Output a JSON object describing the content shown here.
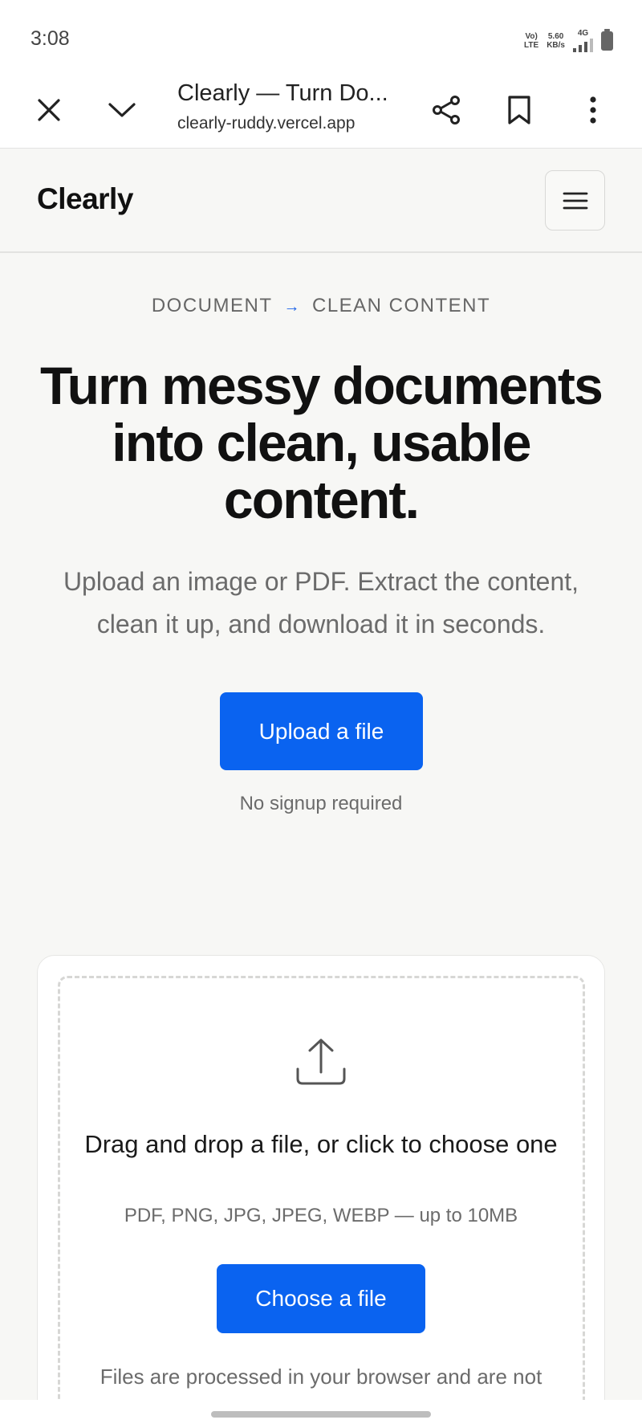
{
  "status_bar": {
    "time": "3:08",
    "network_label_top": "Vo)",
    "network_label_bottom": "LTE",
    "speed_value": "5.60",
    "speed_unit": "KB/s",
    "network_type": "4G"
  },
  "browser": {
    "close_icon": "close-icon",
    "collapse_icon": "chevron-down-icon",
    "page_title": "Clearly — Turn Do...",
    "url": "clearly-ruddy.vercel.app",
    "share_icon": "share-icon",
    "bookmark_icon": "bookmark-icon",
    "more_icon": "more-vertical-icon"
  },
  "header": {
    "brand": "Clearly",
    "menu_icon": "hamburger-menu-icon"
  },
  "hero": {
    "eyebrow_from": "DOCUMENT",
    "eyebrow_arrow": "→",
    "eyebrow_to": "CLEAN CONTENT",
    "headline": "Turn messy documents into clean, usable content.",
    "subtext": "Upload an image or PDF. Extract the content, clean it up, and download it in seconds.",
    "upload_button": "Upload a file",
    "signup_note": "No signup required"
  },
  "dropzone": {
    "icon": "upload-icon",
    "title": "Drag and drop a file, or click to choose one",
    "formats": "PDF, PNG, JPG, JPEG, WEBP — up to 10MB",
    "choose_button": "Choose a file",
    "privacy_note": "Files are processed in your browser and are not uploaded..."
  },
  "colors": {
    "accent": "#0a63f0",
    "page_bg": "#f7f7f5",
    "muted_text": "#6b6b6b"
  }
}
